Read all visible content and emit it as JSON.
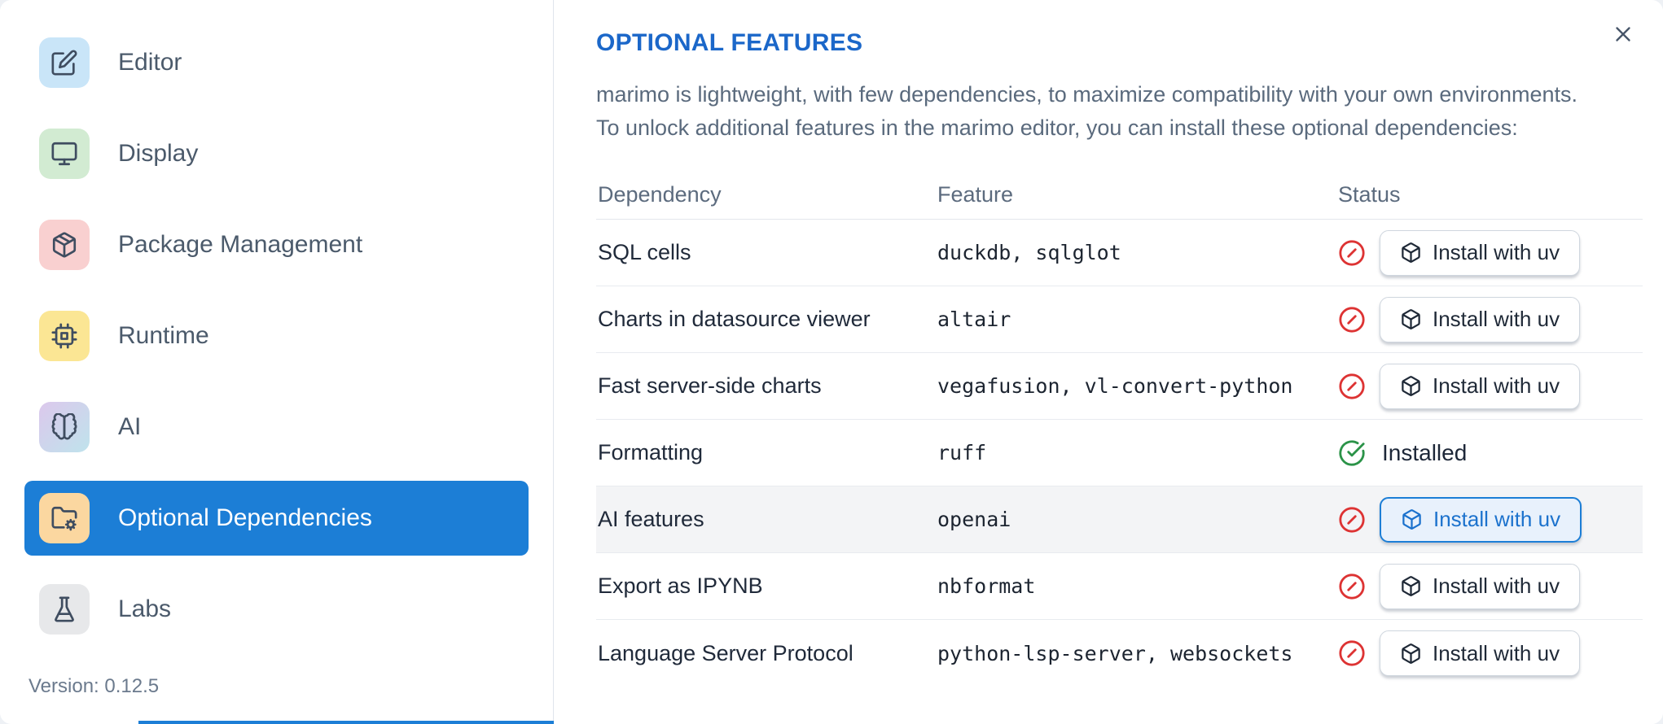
{
  "sidebar": {
    "items": [
      {
        "label": "Editor",
        "icon": "pencil-square-icon",
        "selected": false
      },
      {
        "label": "Display",
        "icon": "monitor-icon",
        "selected": false
      },
      {
        "label": "Package Management",
        "icon": "package-icon",
        "selected": false
      },
      {
        "label": "Runtime",
        "icon": "cpu-icon",
        "selected": false
      },
      {
        "label": "AI",
        "icon": "brain-icon",
        "selected": false
      },
      {
        "label": "Optional Dependencies",
        "icon": "folder-cog-icon",
        "selected": true
      },
      {
        "label": "Labs",
        "icon": "flask-icon",
        "selected": false
      }
    ],
    "version_label": "Version: 0.12.5"
  },
  "main": {
    "title": "OPTIONAL FEATURES",
    "description_line1": "marimo is lightweight, with few dependencies, to maximize compatibility with your own environments.",
    "description_line2": "To unlock additional features in the marimo editor, you can install these optional dependencies:",
    "table": {
      "headers": {
        "dependency": "Dependency",
        "feature": "Feature",
        "status": "Status"
      },
      "rows": [
        {
          "dependency": "SQL cells",
          "feature": "duckdb, sqlglot",
          "status": "missing",
          "action_label": "Install with uv",
          "highlighted": false
        },
        {
          "dependency": "Charts in datasource viewer",
          "feature": "altair",
          "status": "missing",
          "action_label": "Install with uv",
          "highlighted": false
        },
        {
          "dependency": "Fast server-side charts",
          "feature": "vegafusion, vl-convert-python",
          "status": "missing",
          "action_label": "Install with uv",
          "highlighted": false
        },
        {
          "dependency": "Formatting",
          "feature": "ruff",
          "status": "installed",
          "status_label": "Installed",
          "highlighted": false
        },
        {
          "dependency": "AI features",
          "feature": "openai",
          "status": "missing",
          "action_label": "Install with uv",
          "highlighted": true
        },
        {
          "dependency": "Export as IPYNB",
          "feature": "nbformat",
          "status": "missing",
          "action_label": "Install with uv",
          "highlighted": false
        },
        {
          "dependency": "Language Server Protocol",
          "feature": "python-lsp-server, websockets",
          "status": "missing",
          "action_label": "Install with uv",
          "highlighted": false
        }
      ]
    }
  },
  "colors": {
    "accent_blue": "#1c7ed6",
    "title_blue": "#1b67c9",
    "error_red": "#dd3333",
    "success_green": "#2b9348",
    "selected_nav_bg": "#1c7ed6"
  }
}
